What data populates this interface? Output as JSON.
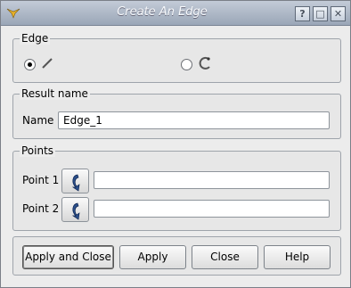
{
  "window": {
    "title": "Create An Edge"
  },
  "titlebar_buttons": {
    "help": "?",
    "maximize": "□",
    "close": "✕"
  },
  "edge_group": {
    "title": "Edge",
    "options": [
      {
        "icon": "line-icon",
        "selected": true
      },
      {
        "icon": "arc-icon",
        "selected": false
      }
    ]
  },
  "result_group": {
    "title": "Result name",
    "name_label": "Name",
    "name_value": "Edge_1"
  },
  "points_group": {
    "title": "Points",
    "point1_label": "Point 1",
    "point2_label": "Point 2",
    "point1_value": "",
    "point2_value": ""
  },
  "buttons": {
    "apply_and_close": "Apply and Close",
    "apply": "Apply",
    "close": "Close",
    "help": "Help"
  }
}
